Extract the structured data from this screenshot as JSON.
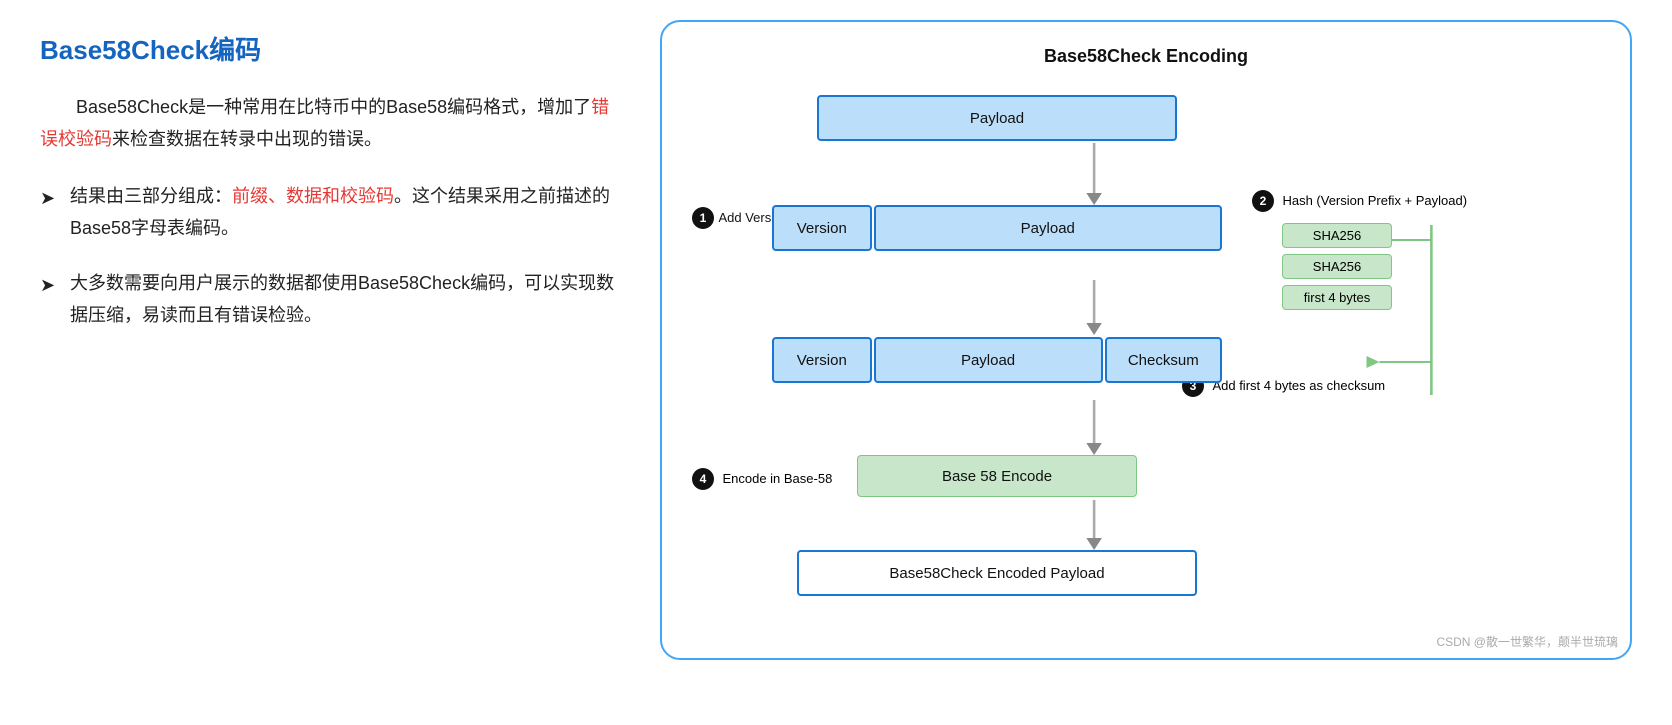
{
  "title": "Base58Check编码",
  "intro": "Base58Check是一种常用在比特币中的Base58编码格式，增加了",
  "intro_red": "错误校验码",
  "intro_suffix": "来检查数据在转录中出现的错误。",
  "bullets": [
    {
      "arrow": "➤",
      "prefix": "结果由三部分组成：",
      "red": "前缀、数据和校验码",
      "suffix": "。这个结果采用之前描述的Base58字母表编码。"
    },
    {
      "arrow": "➤",
      "text": "大多数需要向用户展示的数据都使用Base58Check编码，可以实现数据压缩，易读而且有错误检验。"
    }
  ],
  "diagram": {
    "title": "Base58Check Encoding",
    "step1_label": "Add Version Prefix",
    "step2_label": "Hash (Version Prefix + Payload)",
    "step3_label": "Add first 4 bytes as checksum",
    "step4_label": "Encode in Base-58",
    "sha1": "SHA256",
    "sha2": "SHA256",
    "first4": "first 4 bytes",
    "payload": "Payload",
    "version": "Version",
    "checksum": "Checksum",
    "base58encode": "Base 58 Encode",
    "encoded_payload": "Base58Check Encoded Payload"
  },
  "watermark": "CSDN @散一世繁华，颠半世琉璃"
}
